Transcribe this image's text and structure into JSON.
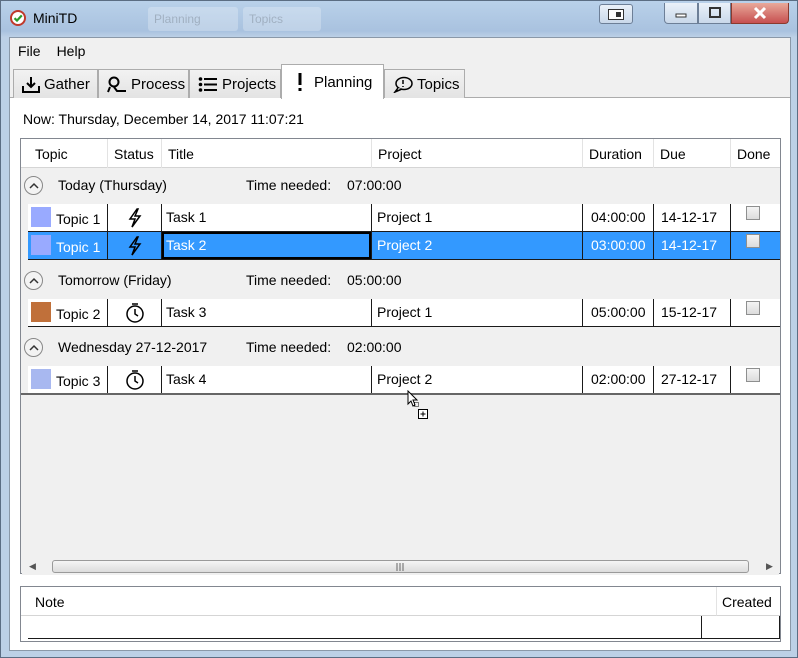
{
  "window": {
    "title": "MiniTD"
  },
  "menu": [
    "File",
    "Help"
  ],
  "tabs": [
    "Gather",
    "Process",
    "Projects",
    "Planning",
    "Topics"
  ],
  "active_tab": "Planning",
  "ghost_tabs": [
    "Planning",
    "Topics"
  ],
  "now": "Now: Thursday, December 14, 2017 11:07:21",
  "columns": [
    "Topic",
    "Status",
    "Title",
    "Project",
    "Duration",
    "Due",
    "Done"
  ],
  "time_needed_label": "Time needed:",
  "groups": [
    {
      "name": "Today (Thursday)",
      "time": "07:00:00",
      "rows": [
        {
          "topic": "Topic 1",
          "color": "#99aaff",
          "status": "lightning-icon",
          "title": "Task 1",
          "project": "Project 1",
          "duration": "04:00:00",
          "due": "14-12-17",
          "done": false,
          "selected": false
        },
        {
          "topic": "Topic 1",
          "color": "#99aaff",
          "status": "lightning-icon",
          "title": "Task 2",
          "project": "Project 2",
          "duration": "03:00:00",
          "due": "14-12-17",
          "done": false,
          "selected": true
        }
      ]
    },
    {
      "name": "Tomorrow (Friday)",
      "time": "05:00:00",
      "rows": [
        {
          "topic": "Topic 2",
          "color": "#c0703a",
          "status": "clock-icon",
          "title": "Task 3",
          "project": "Project 1",
          "duration": "05:00:00",
          "due": "15-12-17",
          "done": false,
          "selected": false
        }
      ]
    },
    {
      "name": "Wednesday 27-12-2017",
      "time": "02:00:00",
      "rows": [
        {
          "topic": "Topic 3",
          "color": "#a8b8f0",
          "status": "clock-icon",
          "title": "Task 4",
          "project": "Project 2",
          "duration": "02:00:00",
          "due": "27-12-17",
          "done": false,
          "selected": false
        }
      ]
    }
  ],
  "notes": {
    "columns": [
      "Note",
      "Created"
    ]
  },
  "colors": {
    "selection": "#3399ff",
    "accent": "#c0392b"
  }
}
